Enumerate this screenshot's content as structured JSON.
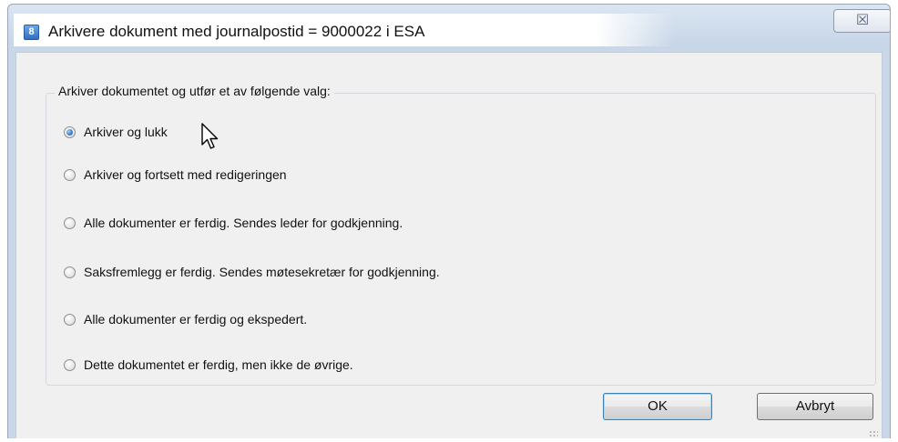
{
  "window": {
    "title": "Arkivere dokument med journalpostid = 9000022 i ESA",
    "app_icon": "8",
    "close_glyph": "☒"
  },
  "group": {
    "legend": "Arkiver dokumentet og utfør et av følgende valg:"
  },
  "options": [
    {
      "label": "Arkiver og lukk",
      "checked": true
    },
    {
      "label": "Arkiver og fortsett med redigeringen",
      "checked": false
    },
    {
      "label": "Alle dokumenter er ferdig. Sendes leder for godkjenning.",
      "checked": false
    },
    {
      "label": "Saksfremlegg er ferdig. Sendes møtesekretær for godkjenning.",
      "checked": false
    },
    {
      "label": "Alle dokumenter er ferdig og ekspedert.",
      "checked": false
    },
    {
      "label": "Dette dokumentet er ferdig, men ikke de øvrige.",
      "checked": false
    }
  ],
  "buttons": {
    "ok": "OK",
    "cancel": "Avbryt"
  },
  "colors": {
    "accent": "#3b82d0",
    "window_frame": "#c7d6e8",
    "client_bg": "#f0f0f0"
  }
}
